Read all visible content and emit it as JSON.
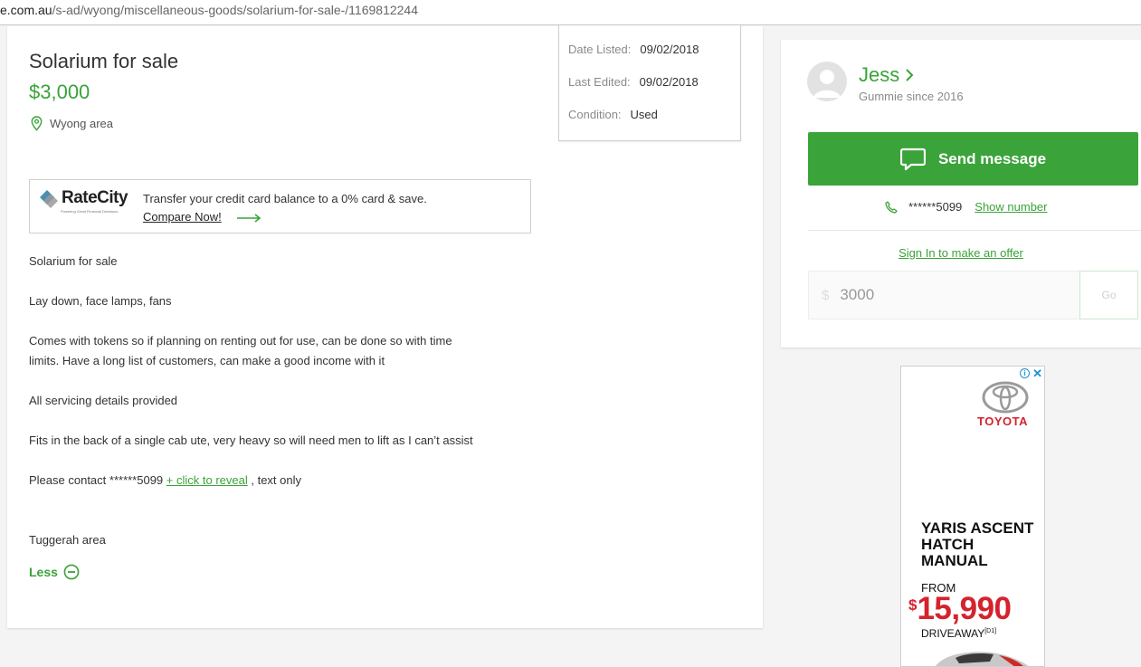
{
  "url": {
    "domain": "e.com.au",
    "path": "/s-ad/wyong/miscellaneous-goods/solarium-for-sale-/1169812244"
  },
  "listing": {
    "title": "Solarium for sale",
    "price": "$3,000",
    "location": "Wyong area",
    "meta": [
      {
        "label": "Date Listed:",
        "value": "09/02/2018"
      },
      {
        "label": "Last Edited:",
        "value": "09/02/2018"
      },
      {
        "label": "Condition:",
        "value": "Used"
      }
    ],
    "description": [
      "Solarium for sale",
      "Lay down, face lamps, fans",
      "Comes with tokens so if planning on renting out for use, can be done so with time",
      "limits. Have a long list of customers, can make a good income with it",
      "All servicing details provided",
      "Fits in the back of a single cab ute, very heavy so will need men to lift as I can’t assist"
    ],
    "contact": {
      "prefix": "Please contact ******5099",
      "link": "+ click to reveal",
      "suffix": " , text only"
    },
    "area_note": "Tuggerah area",
    "less_label": "Less"
  },
  "ratecity_ad": {
    "brand": "RateCity",
    "tagline": "Powering Great Financial Decisions",
    "text": "Transfer your credit card balance to a 0% card & save.",
    "link": "Compare Now!"
  },
  "seller": {
    "name": "Jess",
    "since": "Gummie since 2016",
    "send_label": "Send message",
    "phone_masked": "******5099",
    "show_number": "Show number",
    "signin_offer": "Sign In to make an offer",
    "offer_currency": "$",
    "offer_value": "3000",
    "go_label": "Go"
  },
  "toyota_ad": {
    "brand": "TOYOTA",
    "headline": [
      "YARIS ASCENT",
      "HATCH",
      "MANUAL"
    ],
    "from": "FROM",
    "currency": "$",
    "price": "15,990",
    "driveaway": "DRIVEAWAY",
    "footnote": "[D1]"
  },
  "colors": {
    "accent": "#3aa339",
    "toyota_red": "#d4232d"
  }
}
